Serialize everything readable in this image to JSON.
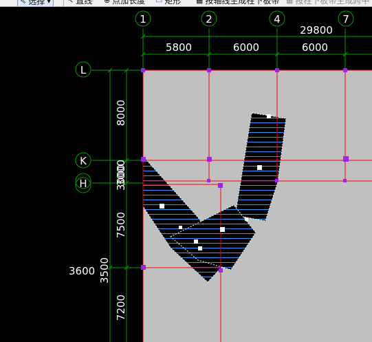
{
  "toolbar": {
    "select_label": "选择",
    "line_label": "直线",
    "point_length_label": "点加长度",
    "rect_label": "矩形",
    "by_axis_label": "按轴线生成柱下板带",
    "by_span_label": "按柱下板带生成跨中"
  },
  "axes": {
    "col_labels": [
      "1",
      "2",
      "4",
      "7"
    ],
    "row_labels": [
      "L",
      "K",
      "H"
    ]
  },
  "dimensions": {
    "total": "29800",
    "spans": [
      "5800",
      "6000",
      "6000"
    ],
    "vertical": [
      "8000",
      "3000",
      "7500",
      "7200"
    ],
    "vertical_outer": [
      "3000",
      "3500"
    ],
    "left_mark": "3600"
  },
  "colors": {
    "background": "#000000",
    "slab": "#c0c0c0",
    "axis": "#ff0000",
    "dimension": "#00a000",
    "column": "#a020f0",
    "strip": "#000000",
    "hatch": "#3399ff"
  }
}
